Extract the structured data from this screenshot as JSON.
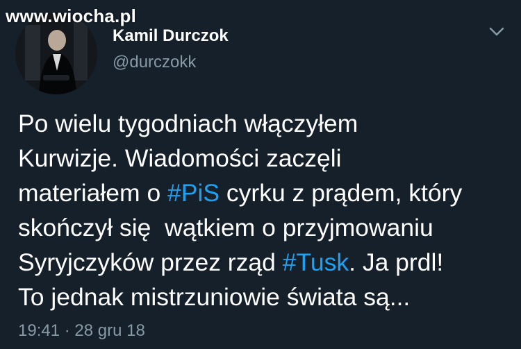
{
  "watermark": {
    "text": "www.wiocha.pl"
  },
  "author": {
    "name": "Kamil Durczok",
    "handle": "@durczokk"
  },
  "icons": {
    "menu": "chevron-down-icon",
    "avatar": "profile-photo"
  },
  "tweet": {
    "lines": [
      {
        "parts": [
          {
            "text": "Po wielu tygodniach włączyłem",
            "hashtag": false
          }
        ]
      },
      {
        "parts": [
          {
            "text": "Kurwizje. Wiadomości zaczęli",
            "hashtag": false
          }
        ]
      },
      {
        "parts": [
          {
            "text": "materiałem o ",
            "hashtag": false
          },
          {
            "text": "#PiS",
            "hashtag": true
          },
          {
            "text": " cyrku z prądem, który",
            "hashtag": false
          }
        ]
      },
      {
        "parts": [
          {
            "text": "skończył się  wątkiem o przyjmowaniu",
            "hashtag": false
          }
        ]
      },
      {
        "parts": [
          {
            "text": "Syryjczyków przez rząd ",
            "hashtag": false
          },
          {
            "text": "#Tusk",
            "hashtag": true
          },
          {
            "text": ". Ja prdl!",
            "hashtag": false
          }
        ]
      },
      {
        "parts": [
          {
            "text": "To jednak mistrzuniowie świata są...",
            "hashtag": false
          }
        ]
      }
    ]
  },
  "timestamp": "19:41 · 28 gru 18",
  "colors": {
    "background": "#15202b",
    "text": "#ffffff",
    "secondary": "#8899a6",
    "hashtag": "#1da1f2"
  }
}
